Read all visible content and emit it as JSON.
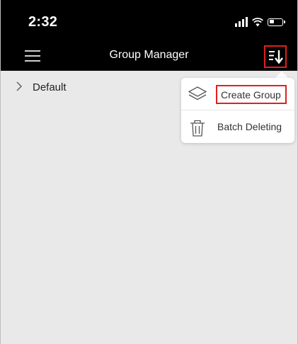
{
  "status_bar": {
    "time": "2:32"
  },
  "nav_bar": {
    "title": "Group Manager",
    "menu_icon": "hamburger-menu-icon",
    "sort_icon": "sort-descending-icon"
  },
  "groups": [
    {
      "label": "Default",
      "icon": "chevron-right-icon"
    }
  ],
  "popover_menu": {
    "items": [
      {
        "label": "Create Group",
        "icon": "layers-icon"
      },
      {
        "label": "Batch Deleting",
        "icon": "trash-icon"
      }
    ]
  },
  "colors": {
    "bar_background": "#000000",
    "content_background": "#e9e9e9",
    "highlight": "#e02020"
  }
}
